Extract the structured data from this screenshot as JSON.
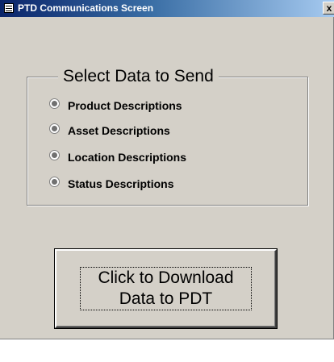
{
  "window": {
    "title": "PTD Communications Screen",
    "close_glyph": "x"
  },
  "group": {
    "label": "Select Data to Send",
    "options": [
      {
        "label": "Product Descriptions"
      },
      {
        "label": "Asset Descriptions"
      },
      {
        "label": "Location Descriptions"
      },
      {
        "label": "Status Descriptions"
      }
    ]
  },
  "download_button": {
    "line1": "Click to Download",
    "line2": "Data to PDT"
  },
  "icons": {
    "title": "form-icon",
    "radio": "radio-button-icon"
  }
}
